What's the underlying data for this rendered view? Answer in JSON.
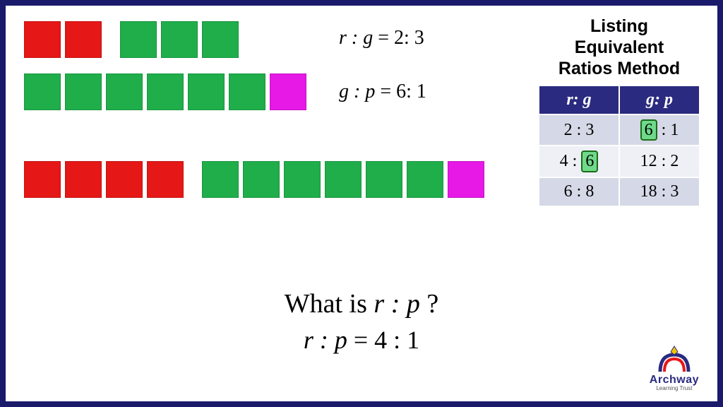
{
  "row1": {
    "red": 2,
    "green": 3,
    "pink": 0,
    "label_vars": "r : g",
    "label_val": "2: 3"
  },
  "row2": {
    "red": 0,
    "green": 6,
    "pink": 1,
    "label_vars": "g : p",
    "label_val": "6: 1"
  },
  "row3": {
    "red": 4,
    "green": 6,
    "pink": 1
  },
  "question_prefix": "What is ",
  "question_vars": "r : p",
  "question_suffix": " ?",
  "answer_vars": "r : p",
  "answer_eq": " = 4 : 1",
  "right": {
    "title_l1": "Listing",
    "title_l2": "Equivalent",
    "title_l3": "Ratios Method",
    "headers": [
      "r: g",
      "g: p"
    ],
    "rows": [
      {
        "c1": {
          "pre": "2 : 3",
          "hl": null
        },
        "c2": {
          "pre": "",
          "hl": "6",
          "post": " : 1"
        }
      },
      {
        "c1": {
          "pre": "4 : ",
          "hl": "6",
          "post": ""
        },
        "c2": {
          "pre": "12 : 2",
          "hl": null
        }
      },
      {
        "c1": {
          "pre": "6 : 8",
          "hl": null
        },
        "c2": {
          "pre": "18 : 3",
          "hl": null
        }
      }
    ]
  },
  "logo": {
    "name": "Archway",
    "sub": "Learning Trust"
  },
  "colors": {
    "red": "#e61717",
    "green": "#1fae4a",
    "pink": "#e619e6",
    "navy": "#1a1a6b"
  }
}
